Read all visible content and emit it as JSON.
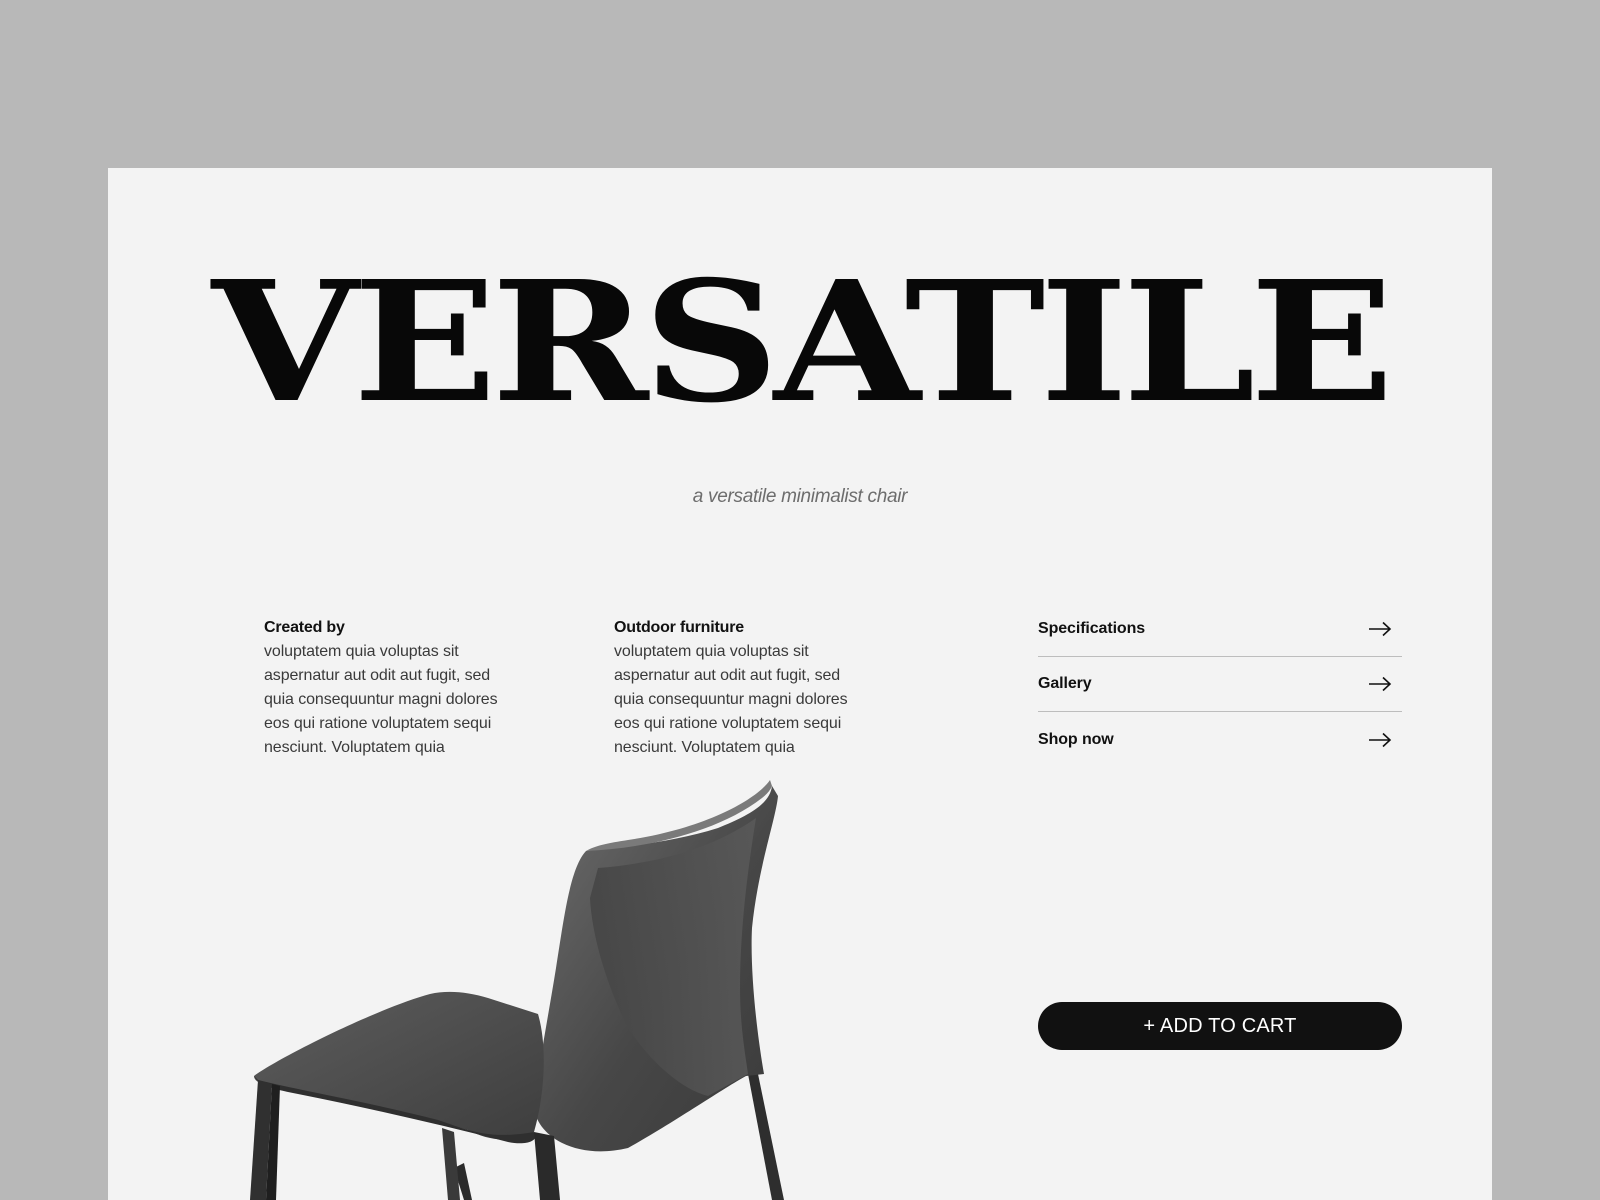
{
  "hero": {
    "title": "VERSATILE",
    "tagline": "a versatile minimalist chair"
  },
  "info": [
    {
      "heading": "Created by",
      "body": "voluptatem quia voluptas sit aspernatur aut odit aut fugit, sed quia consequuntur magni dolores eos qui ratione voluptatem sequi nesciunt. Voluptatem quia"
    },
    {
      "heading": "Outdoor furniture",
      "body": "voluptatem quia voluptas sit aspernatur aut odit aut fugit, sed quia consequuntur magni dolores eos qui ratione voluptatem sequi nesciunt. Voluptatem quia"
    }
  ],
  "links": [
    {
      "label": "Specifications",
      "icon": "arrow-right-icon"
    },
    {
      "label": "Gallery",
      "icon": "arrow-right-icon"
    },
    {
      "label": "Shop now",
      "icon": "arrow-right-icon"
    }
  ],
  "cart": {
    "label": "+ ADD TO CART"
  },
  "product_image": {
    "subject": "chair"
  },
  "colors": {
    "backdrop": "#b8b8b8",
    "page": "#f3f3f3",
    "text": "#111111",
    "button": "#111111"
  }
}
